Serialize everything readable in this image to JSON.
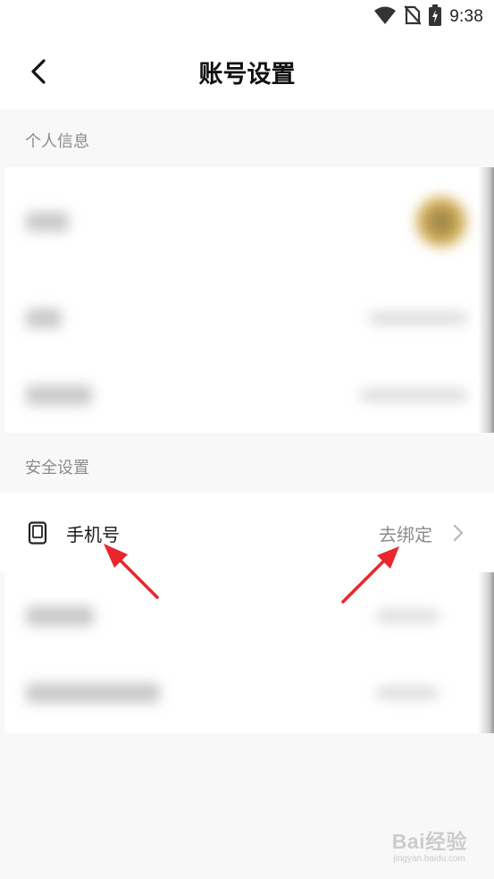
{
  "status_bar": {
    "time": "9:38",
    "icons": [
      "wifi-icon",
      "no-sim-icon",
      "battery-charging-icon"
    ]
  },
  "header": {
    "title": "账号设置",
    "back_icon": "chevron-left-icon"
  },
  "sections": {
    "personal_info": {
      "label": "个人信息"
    },
    "security": {
      "label": "安全设置"
    }
  },
  "phone_row": {
    "icon": "phone-icon",
    "label": "手机号",
    "value": "去绑定",
    "chevron_icon": "chevron-right-icon"
  },
  "annotation": {
    "arrow_color": "#e8262b"
  },
  "watermark": {
    "brand": "Bai经验",
    "url": "jingyan.baidu.com"
  }
}
